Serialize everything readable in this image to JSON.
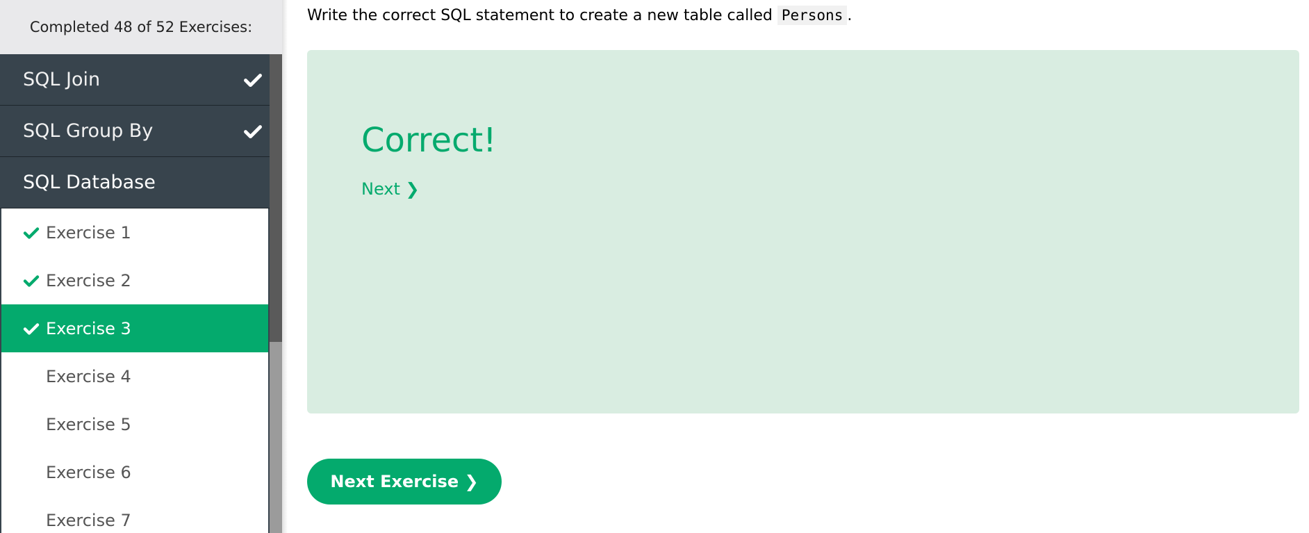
{
  "sidebar": {
    "progress_text": "Completed 48 of 52 Exercises:",
    "chapters": [
      {
        "label": "SQL Join",
        "completed": true,
        "check_icon": "check-icon"
      },
      {
        "label": "SQL Group By",
        "completed": true,
        "check_icon": "check-icon"
      },
      {
        "label": "SQL Database",
        "completed": false
      }
    ],
    "exercises": [
      {
        "label": "Exercise 1",
        "completed": true
      },
      {
        "label": "Exercise 2",
        "completed": true
      },
      {
        "label": "Exercise 3",
        "completed": true,
        "active": true
      },
      {
        "label": "Exercise 4",
        "completed": false
      },
      {
        "label": "Exercise 5",
        "completed": false
      },
      {
        "label": "Exercise 6",
        "completed": false
      },
      {
        "label": "Exercise 7",
        "completed": false
      }
    ]
  },
  "main": {
    "instruction_prefix": "Write the correct SQL statement to create a new table called ",
    "instruction_code": "Persons",
    "instruction_suffix": ".",
    "result_title": "Correct!",
    "next_link_label": "Next ❯",
    "next_exercise_label": "Next Exercise ❯"
  },
  "colors": {
    "accent": "#04aa6d",
    "sidebar_dark": "#38444d",
    "result_bg": "#d9ede1",
    "header_bg": "#e9e9eb"
  }
}
